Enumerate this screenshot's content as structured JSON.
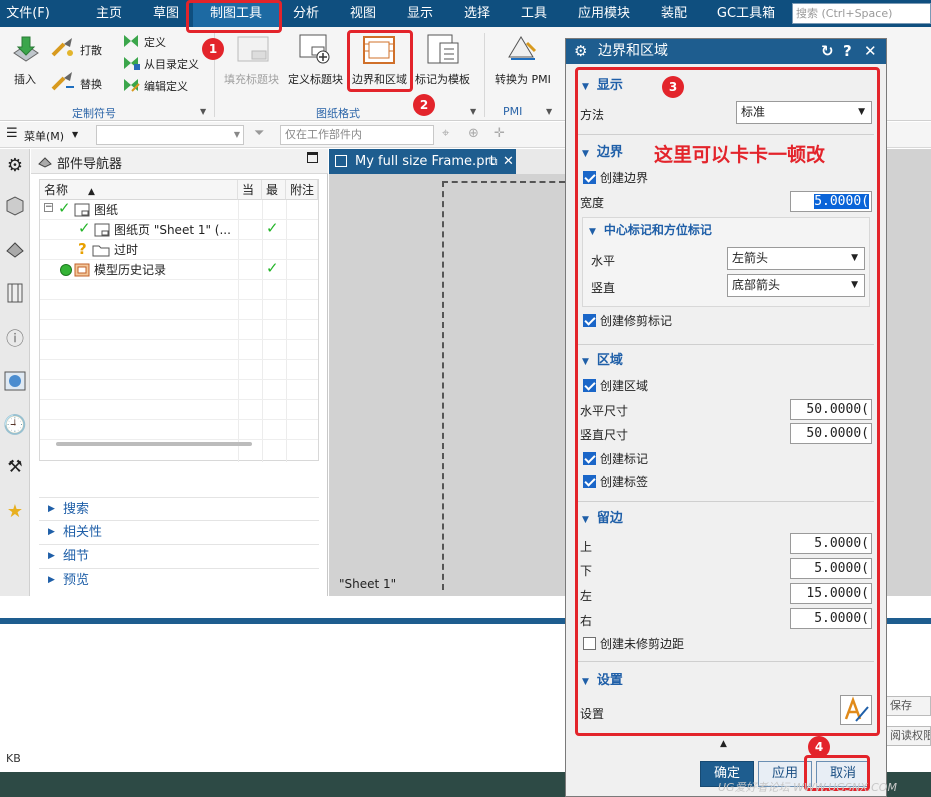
{
  "menu": {
    "items": [
      "文件(F)",
      "主页",
      "草图",
      "制图工具",
      "分析",
      "视图",
      "显示",
      "选择",
      "工具",
      "应用模块",
      "装配",
      "GC工具箱"
    ],
    "search_placeholder": "搜索 (Ctrl+Space)"
  },
  "ribbon": {
    "insert": "插入",
    "scatter": "打散",
    "replace": "替换",
    "define": "定义",
    "define_from_dir": "从目录定义",
    "edit_define": "编辑定义",
    "group_symbol": "定制符号",
    "fill_title": "填充标题块",
    "define_title": "定义标题块",
    "border_zone": "边界和区域",
    "mark_template": "标记为模板",
    "group_sheet": "图纸格式",
    "convert_pmi": "转换为 PMI",
    "group_pmi": "PMI"
  },
  "toolbar": {
    "menu_label": "菜单(M)",
    "filter_placeholder": "仅在工作部件内"
  },
  "navigator": {
    "title": "部件导航器",
    "columns": [
      "名称",
      "当",
      "最",
      "附注"
    ],
    "rows": [
      {
        "name": "图纸"
      },
      {
        "name": "图纸页 \"Sheet 1\" (..."
      },
      {
        "name": "过时"
      },
      {
        "name": "模型历史记录"
      }
    ],
    "panels": [
      "搜索",
      "相关性",
      "细节",
      "预览"
    ]
  },
  "graphics": {
    "tab_title": "My full size Frame.prt",
    "sheet_label": "\"Sheet 1\""
  },
  "dialog": {
    "title": "边界和区域",
    "display": {
      "header": "显示",
      "method_label": "方法",
      "method_value": "标准"
    },
    "border": {
      "header": "边界",
      "create_border": "创建边界",
      "width_label": "宽度",
      "width_value": "5.0000(",
      "center_header": "中心标记和方位标记",
      "horizontal_label": "水平",
      "horizontal_value": "左箭头",
      "vertical_label": "竖直",
      "vertical_value": "底部箭头",
      "create_trim": "创建修剪标记"
    },
    "zone": {
      "header": "区域",
      "create_zone": "创建区域",
      "h_size_label": "水平尺寸",
      "h_size_value": "50.0000(",
      "v_size_label": "竖直尺寸",
      "v_size_value": "50.0000(",
      "create_marks": "创建标记",
      "create_labels": "创建标签"
    },
    "margin": {
      "header": "留边",
      "top_label": "上",
      "top_value": "5.0000(",
      "bottom_label": "下",
      "bottom_value": "5.0000(",
      "left_label": "左",
      "left_value": "15.0000(",
      "right_label": "右",
      "right_value": "5.0000(",
      "untrimmed": "创建未修剪边距"
    },
    "settings": {
      "header": "设置",
      "label": "设置"
    },
    "buttons": {
      "ok": "确定",
      "apply": "应用",
      "cancel": "取消"
    }
  },
  "status": {
    "kb": "KB",
    "save_side": "保存",
    "read_perm": "阅读权限"
  },
  "annotations": {
    "badges": [
      "1",
      "2",
      "3",
      "4"
    ],
    "note": "这里可以卡卡一顿改",
    "watermark": "UG爱好者论坛 WWW.UGSNX.COM"
  },
  "colors": {
    "menubar": "#0f4f7f",
    "accent_blue": "#1e5d8f",
    "annotation_red": "#e3242b",
    "check_green": "#25b52a"
  }
}
